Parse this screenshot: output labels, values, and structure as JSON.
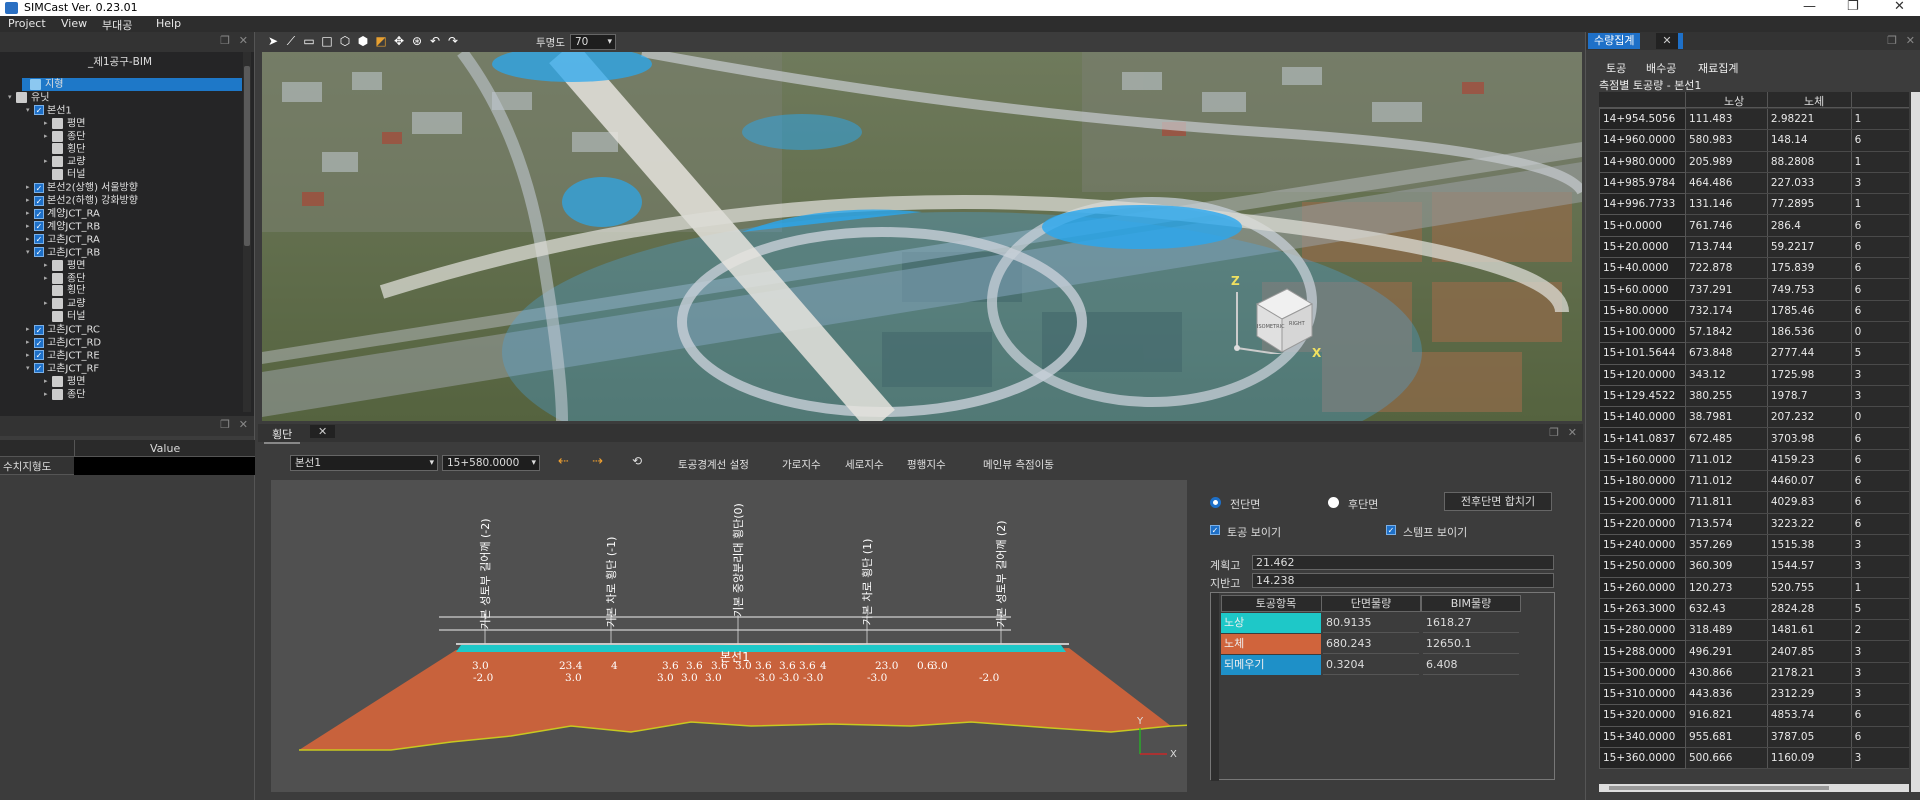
{
  "app": {
    "title": "SIMCast Ver. 0.23.01"
  },
  "menu": [
    "Project",
    "View",
    "부대공",
    "Help"
  ],
  "toolbar": {
    "opacity_label": "투명도",
    "opacity_value": "70"
  },
  "tree": {
    "header": "_제1공구-BIM",
    "items": [
      {
        "label": "지형",
        "level": 0,
        "icon": "terrain-icon",
        "selected": true
      },
      {
        "label": "유닛",
        "level": 0,
        "icon": "unit-icon",
        "expander": "▾"
      },
      {
        "label": "본선1",
        "level": 1,
        "check": true,
        "expander": "▾"
      },
      {
        "label": "평면",
        "level": 2,
        "icon": "plan-icon",
        "expander": "▸"
      },
      {
        "label": "종단",
        "level": 2,
        "icon": "profile-icon",
        "expander": "▸"
      },
      {
        "label": "횡단",
        "level": 2,
        "icon": "cross-section-icon"
      },
      {
        "label": "교량",
        "level": 2,
        "icon": "bridge-icon",
        "expander": "▸"
      },
      {
        "label": "터널",
        "level": 2,
        "icon": "tunnel-icon"
      },
      {
        "label": "본선2(상행) 서울방향",
        "level": 1,
        "check": true,
        "expander": "▸"
      },
      {
        "label": "본선2(하행) 강화방향",
        "level": 1,
        "check": true,
        "expander": "▸"
      },
      {
        "label": "계양JCT_RA",
        "level": 1,
        "check": true,
        "expander": "▸"
      },
      {
        "label": "계양JCT_RB",
        "level": 1,
        "check": true,
        "expander": "▸"
      },
      {
        "label": "고촌JCT_RA",
        "level": 1,
        "check": true,
        "expander": "▸"
      },
      {
        "label": "고촌JCT_RB",
        "level": 1,
        "check": true,
        "expander": "▾"
      },
      {
        "label": "평면",
        "level": 2,
        "icon": "plan-icon",
        "expander": "▸"
      },
      {
        "label": "종단",
        "level": 2,
        "icon": "profile-icon",
        "expander": "▸"
      },
      {
        "label": "횡단",
        "level": 2,
        "icon": "cross-section-icon"
      },
      {
        "label": "교량",
        "level": 2,
        "icon": "bridge-icon",
        "expander": "▸"
      },
      {
        "label": "터널",
        "level": 2,
        "icon": "tunnel-icon"
      },
      {
        "label": "고촌JCT_RC",
        "level": 1,
        "check": true,
        "expander": "▸"
      },
      {
        "label": "고촌JCT_RD",
        "level": 1,
        "check": true,
        "expander": "▸"
      },
      {
        "label": "고촌JCT_RE",
        "level": 1,
        "check": true,
        "expander": "▸"
      },
      {
        "label": "고촌JCT_RF",
        "level": 1,
        "check": true,
        "expander": "▾"
      },
      {
        "label": "평면",
        "level": 2,
        "icon": "plan-icon",
        "expander": "▸"
      },
      {
        "label": "종단",
        "level": 2,
        "icon": "profile-icon",
        "expander": "▸"
      }
    ]
  },
  "props": {
    "value_header": "Value",
    "row_label": "수치지형도"
  },
  "viewport": {
    "axis_z": "Z",
    "axis_x": "X",
    "cube_left": "ISOMETRIC",
    "cube_right": "RIGHT"
  },
  "section": {
    "tab": "횡단",
    "alignment": "본선1",
    "station": "15+580.0000",
    "buttons": [
      "토공경계선 설정",
      "가로지수",
      "세로지수",
      "평행지수",
      "메인뷰 측점이동"
    ],
    "radio_full": "전단면",
    "radio_after": "후단면",
    "merge_button": "전후단면 합치기",
    "chk_earth": "토공 보이기",
    "chk_stamp": "스템프 보이기",
    "plan_label": "계획고",
    "plan_value": "21.462",
    "ground_label": "지반고",
    "ground_value": "14.238",
    "table_headers": [
      "토공항목",
      "단면물량",
      "BIM물량"
    ],
    "table_rows": [
      {
        "name": "노상",
        "a": "80.9135",
        "b": "1618.27",
        "color": "#1ec8c8"
      },
      {
        "name": "노체",
        "a": "680.243",
        "b": "12650.1",
        "color": "#d0643c"
      },
      {
        "name": "되메우기",
        "a": "0.3204",
        "b": "6.408",
        "color": "#1e90c8"
      }
    ],
    "drawing": {
      "title": "본선1",
      "vlabels": [
        "기본 성토부 길어깨 (-2)",
        "기본 차로 횡단 (-1)",
        "기본 중앙분리대 횡단(0)",
        "기본 차로 횡단 (1)",
        "기본 성토부 길어깨 (2)"
      ],
      "dims_top": [
        "3.0",
        "23.4",
        "4",
        "3.6",
        "3.6",
        "3.6",
        "3.0",
        "3.6",
        "3.6",
        "3.6",
        "4",
        "23.0",
        "0.6",
        "3.0"
      ],
      "dims_bot": [
        "-2.0",
        "3.0",
        "3.0",
        "3.0",
        "3.0",
        "-3.0",
        "-3.0",
        "-3.0",
        "-3.0",
        "-2.0"
      ],
      "axis_y": "Y",
      "axis_x": "X"
    }
  },
  "quantities": {
    "tab": "수량집계",
    "subtabs": [
      "토공",
      "배수공",
      "재료집계"
    ],
    "subtitle": "측점별 토공량 - 본선1",
    "headers": [
      "",
      "노상",
      "노체",
      ""
    ],
    "rows": [
      [
        "14+954.5056",
        "111.483",
        "2.98221",
        "1"
      ],
      [
        "14+960.0000",
        "580.983",
        "148.14",
        "6"
      ],
      [
        "14+980.0000",
        "205.989",
        "88.2808",
        "1"
      ],
      [
        "14+985.9784",
        "464.486",
        "227.033",
        "3"
      ],
      [
        "14+996.7733",
        "131.146",
        "77.2895",
        "1"
      ],
      [
        "15+0.0000",
        "761.746",
        "286.4",
        "6"
      ],
      [
        "15+20.0000",
        "713.744",
        "59.2217",
        "6"
      ],
      [
        "15+40.0000",
        "722.878",
        "175.839",
        "6"
      ],
      [
        "15+60.0000",
        "737.291",
        "749.753",
        "6"
      ],
      [
        "15+80.0000",
        "732.174",
        "1785.46",
        "6"
      ],
      [
        "15+100.0000",
        "57.1842",
        "186.536",
        "0"
      ],
      [
        "15+101.5644",
        "673.848",
        "2777.44",
        "5"
      ],
      [
        "15+120.0000",
        "343.12",
        "1725.98",
        "3"
      ],
      [
        "15+129.4522",
        "380.255",
        "1978.7",
        "3"
      ],
      [
        "15+140.0000",
        "38.7981",
        "207.232",
        "0"
      ],
      [
        "15+141.0837",
        "672.485",
        "3703.98",
        "6"
      ],
      [
        "15+160.0000",
        "711.012",
        "4159.23",
        "6"
      ],
      [
        "15+180.0000",
        "711.012",
        "4460.07",
        "6"
      ],
      [
        "15+200.0000",
        "711.811",
        "4029.83",
        "6"
      ],
      [
        "15+220.0000",
        "713.574",
        "3223.22",
        "6"
      ],
      [
        "15+240.0000",
        "357.269",
        "1515.38",
        "3"
      ],
      [
        "15+250.0000",
        "360.309",
        "1544.57",
        "3"
      ],
      [
        "15+260.0000",
        "120.273",
        "520.755",
        "1"
      ],
      [
        "15+263.3000",
        "632.43",
        "2824.28",
        "5"
      ],
      [
        "15+280.0000",
        "318.489",
        "1481.61",
        "2"
      ],
      [
        "15+288.0000",
        "496.291",
        "2407.85",
        "3"
      ],
      [
        "15+300.0000",
        "430.866",
        "2178.21",
        "3"
      ],
      [
        "15+310.0000",
        "443.836",
        "2312.29",
        "3"
      ],
      [
        "15+320.0000",
        "916.821",
        "4853.74",
        "6"
      ],
      [
        "15+340.0000",
        "955.681",
        "3787.05",
        "6"
      ],
      [
        "15+360.0000",
        "500.666",
        "1160.09",
        "3"
      ]
    ]
  }
}
